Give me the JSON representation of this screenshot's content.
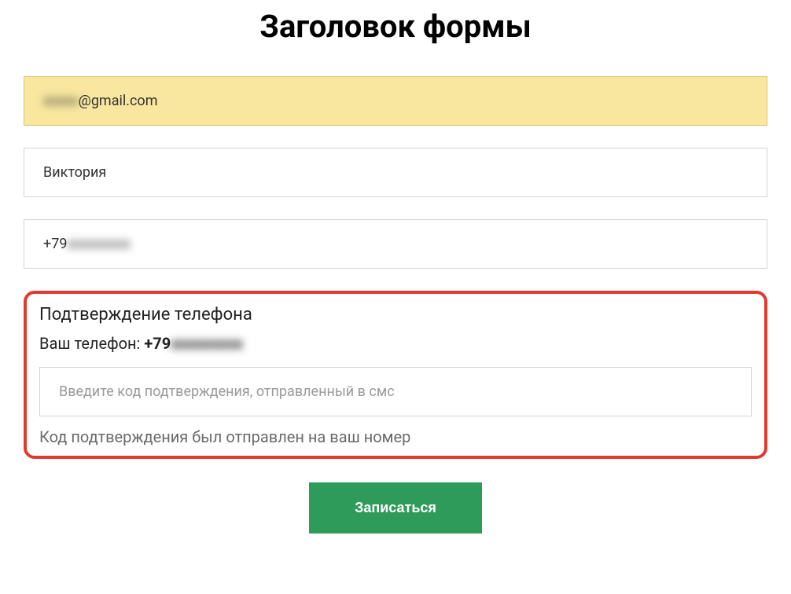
{
  "form": {
    "title": "Заголовок формы",
    "email": {
      "prefix_masked": "xxxxx",
      "suffix": "@gmail.com"
    },
    "name": "Виктория",
    "phone": {
      "prefix": "+79",
      "masked_rest": "xxxxxxxxx"
    },
    "confirmation": {
      "title": "Подтверждение телефона",
      "your_phone_label": "Ваш телефон: ",
      "phone_prefix": "+79",
      "phone_masked_rest": "xxxxxxxxx",
      "code_placeholder": "Введите код подтверждения, отправленный в смс",
      "sent_message": "Код подтверждения был отправлен на ваш номер"
    },
    "submit_label": "Записаться"
  },
  "colors": {
    "highlight_border": "#e03a2f",
    "autofill_bg": "#f9e7a0",
    "button_bg": "#2e9b5a"
  }
}
